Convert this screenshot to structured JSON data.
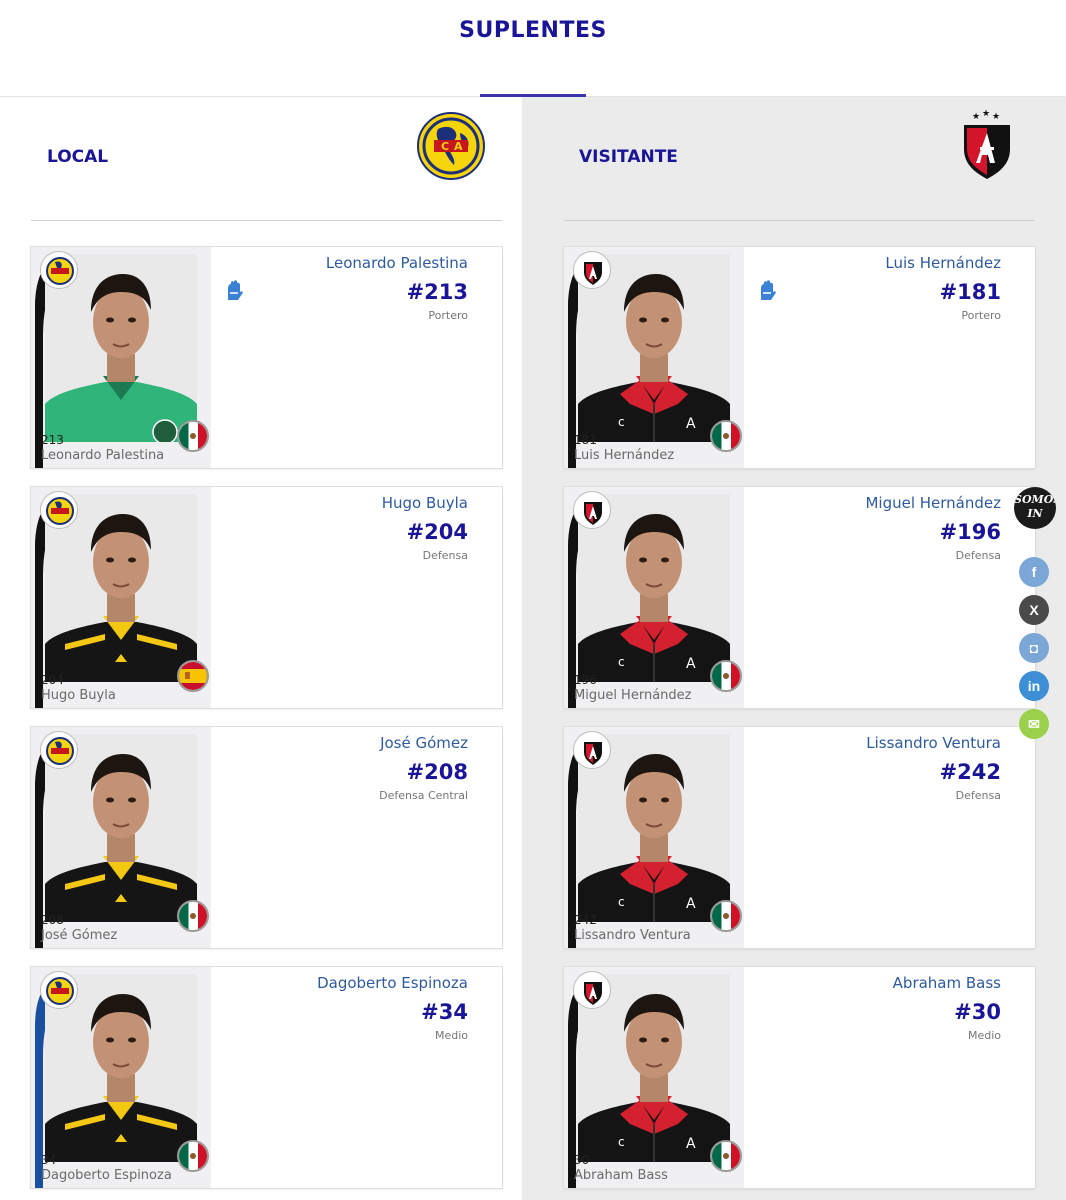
{
  "section_title": "SUPLENTES",
  "local": {
    "label": "LOCAL",
    "team_logo": "club-america-logo",
    "players": [
      {
        "name": "Leonardo Palestina",
        "number": "#213",
        "shirt": "213",
        "position": "Portero",
        "flag": "mexico-flag",
        "goalkeeper_icon": "glove-icon",
        "kit": "green"
      },
      {
        "name": "Hugo Buyla",
        "number": "#204",
        "shirt": "204",
        "position": "Defensa",
        "flag": "spain-flag",
        "kit": "black-yellow"
      },
      {
        "name": "José Gómez",
        "number": "#208",
        "shirt": "208",
        "position": "Defensa Central",
        "flag": "mexico-flag",
        "kit": "black-yellow"
      },
      {
        "name": "Dagoberto Espinoza",
        "number": "#34",
        "shirt": "34",
        "position": "Medio",
        "flag": "mexico-flag",
        "kit": "black-yellow"
      }
    ]
  },
  "visitante": {
    "label": "VISITANTE",
    "team_logo": "atlas-logo",
    "players": [
      {
        "name": "Luis Hernández",
        "number": "#181",
        "shirt": "181",
        "position": "Portero",
        "flag": "mexico-flag",
        "goalkeeper_icon": "glove-icon",
        "kit": "black-red"
      },
      {
        "name": "Miguel Hernández",
        "number": "#196",
        "shirt": "196",
        "position": "Defensa",
        "flag": "mexico-flag",
        "kit": "black-red"
      },
      {
        "name": "Lissandro Ventura",
        "number": "#242",
        "shirt": "242",
        "position": "Defensa",
        "flag": "mexico-flag",
        "kit": "black-red"
      },
      {
        "name": "Abraham Bass",
        "number": "#30",
        "shirt": "30",
        "position": "Medio",
        "flag": "mexico-flag",
        "kit": "black-red"
      }
    ]
  },
  "social": {
    "brand": [
      "SOMOS",
      "IN"
    ],
    "buttons": [
      {
        "icon": "facebook-icon",
        "glyph": "f",
        "color": "#7aa7d6"
      },
      {
        "icon": "x-icon",
        "glyph": "X",
        "color": "#4a4a4a"
      },
      {
        "icon": "instagram-icon",
        "glyph": "◘",
        "color": "#7aa7d6"
      },
      {
        "icon": "linkedin-icon",
        "glyph": "in",
        "color": "#3c8ed6"
      },
      {
        "icon": "email-icon",
        "glyph": "✉",
        "color": "#9bd14a"
      }
    ]
  },
  "colors": {
    "title": "#1a1496",
    "player_name": "#2e5a9e",
    "number": "#1a1496",
    "visitante_bg": "#ebebeb"
  }
}
